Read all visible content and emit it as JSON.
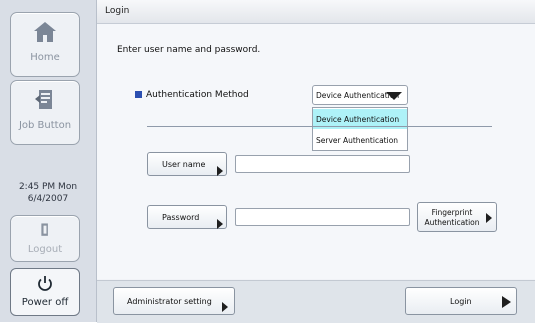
{
  "sidebar": {
    "home_label": "Home",
    "job_button_label": "Job Button",
    "clock_time": "2:45 PM  Mon",
    "clock_date": "6/4/2007",
    "logout_label": "Logout",
    "power_label": "Power off"
  },
  "header": {
    "title": "Login"
  },
  "main": {
    "instruction": "Enter user name and password.",
    "auth_method_label": "Authentication Method",
    "auth_selected": "Device Authentication",
    "auth_options": [
      "Device Authentication",
      "Server Authentication"
    ],
    "user_name_label": "User name",
    "user_name_value": "",
    "password_label": "Password",
    "password_value": "",
    "fingerprint_line1": "Fingerprint",
    "fingerprint_line2": "Authentication"
  },
  "footer": {
    "admin_label": "Administrator setting",
    "login_label": "Login"
  },
  "colors": {
    "accent_square": "#2b4fb0",
    "menu_highlight": "#aef2f8"
  },
  "icons": [
    "home-icon",
    "job-button-icon",
    "logout-icon",
    "power-icon",
    "dropdown-caret-icon",
    "play-arrow-icon"
  ]
}
